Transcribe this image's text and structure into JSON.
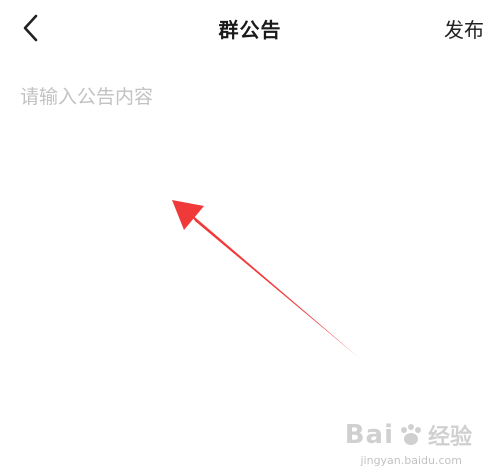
{
  "header": {
    "title": "群公告",
    "publish_label": "发布"
  },
  "editor": {
    "placeholder": "请输入公告内容"
  },
  "watermark": {
    "brand": "Bai",
    "suffix": "经验",
    "url": "jingyan.baidu.com"
  },
  "colors": {
    "arrow": "#f03a3a",
    "placeholder": "#c2c2c2",
    "title": "#1a1a1a"
  },
  "icons": {
    "back": "chevron-left-icon",
    "watermark_logo": "paw-icon"
  }
}
